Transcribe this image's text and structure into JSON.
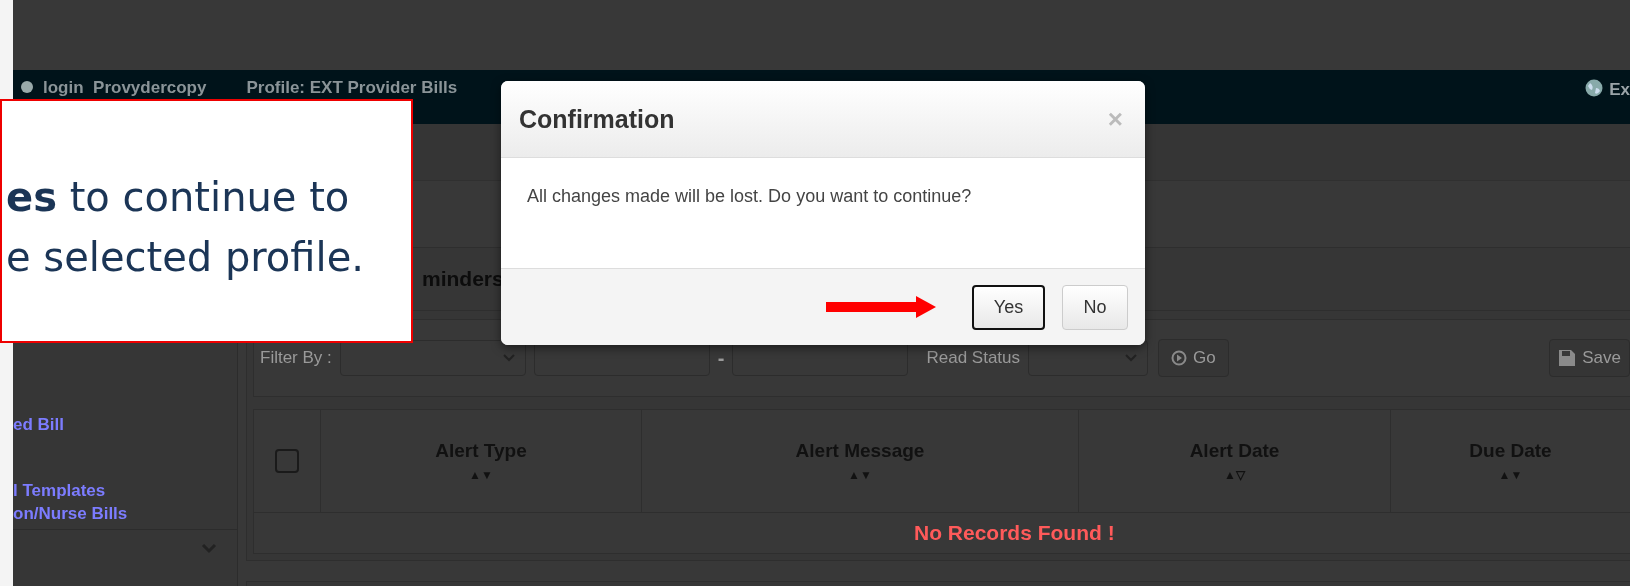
{
  "navbar": {
    "user": "login  Provydercopy",
    "profile": "Profile: EXT Provider Bills",
    "right_text": "Ex"
  },
  "sidebar": {
    "items": [
      {
        "lines": [
          "ed Bill"
        ]
      },
      {
        "lines": [
          "l Templates",
          "on/Nurse Bills"
        ]
      }
    ]
  },
  "panel": {
    "title": "minders",
    "filter": {
      "label": "Filter By :",
      "separator": "-",
      "status_label": "Read Status",
      "go_button": "Go",
      "save_button": "Save"
    },
    "table": {
      "select_all": {
        "checked": false
      },
      "columns": [
        {
          "label": "Alert Type",
          "sort": "▲▼"
        },
        {
          "label": "Alert Message",
          "sort": "▲▼"
        },
        {
          "label": "Alert Date",
          "sort": "▲▽"
        },
        {
          "label": "Due Date",
          "sort": "▲▼"
        }
      ],
      "empty_message": "No Records Found !"
    }
  },
  "callout": {
    "lines": [
      "**es** to continue to",
      "e selected profile."
    ]
  },
  "dialog": {
    "title": "Confirmation",
    "close": "×",
    "message": "All changes made will be lost. Do you want to continue?",
    "buttons": [
      {
        "label": "Yes",
        "selected": true
      },
      {
        "label": "No",
        "selected": false
      }
    ]
  }
}
